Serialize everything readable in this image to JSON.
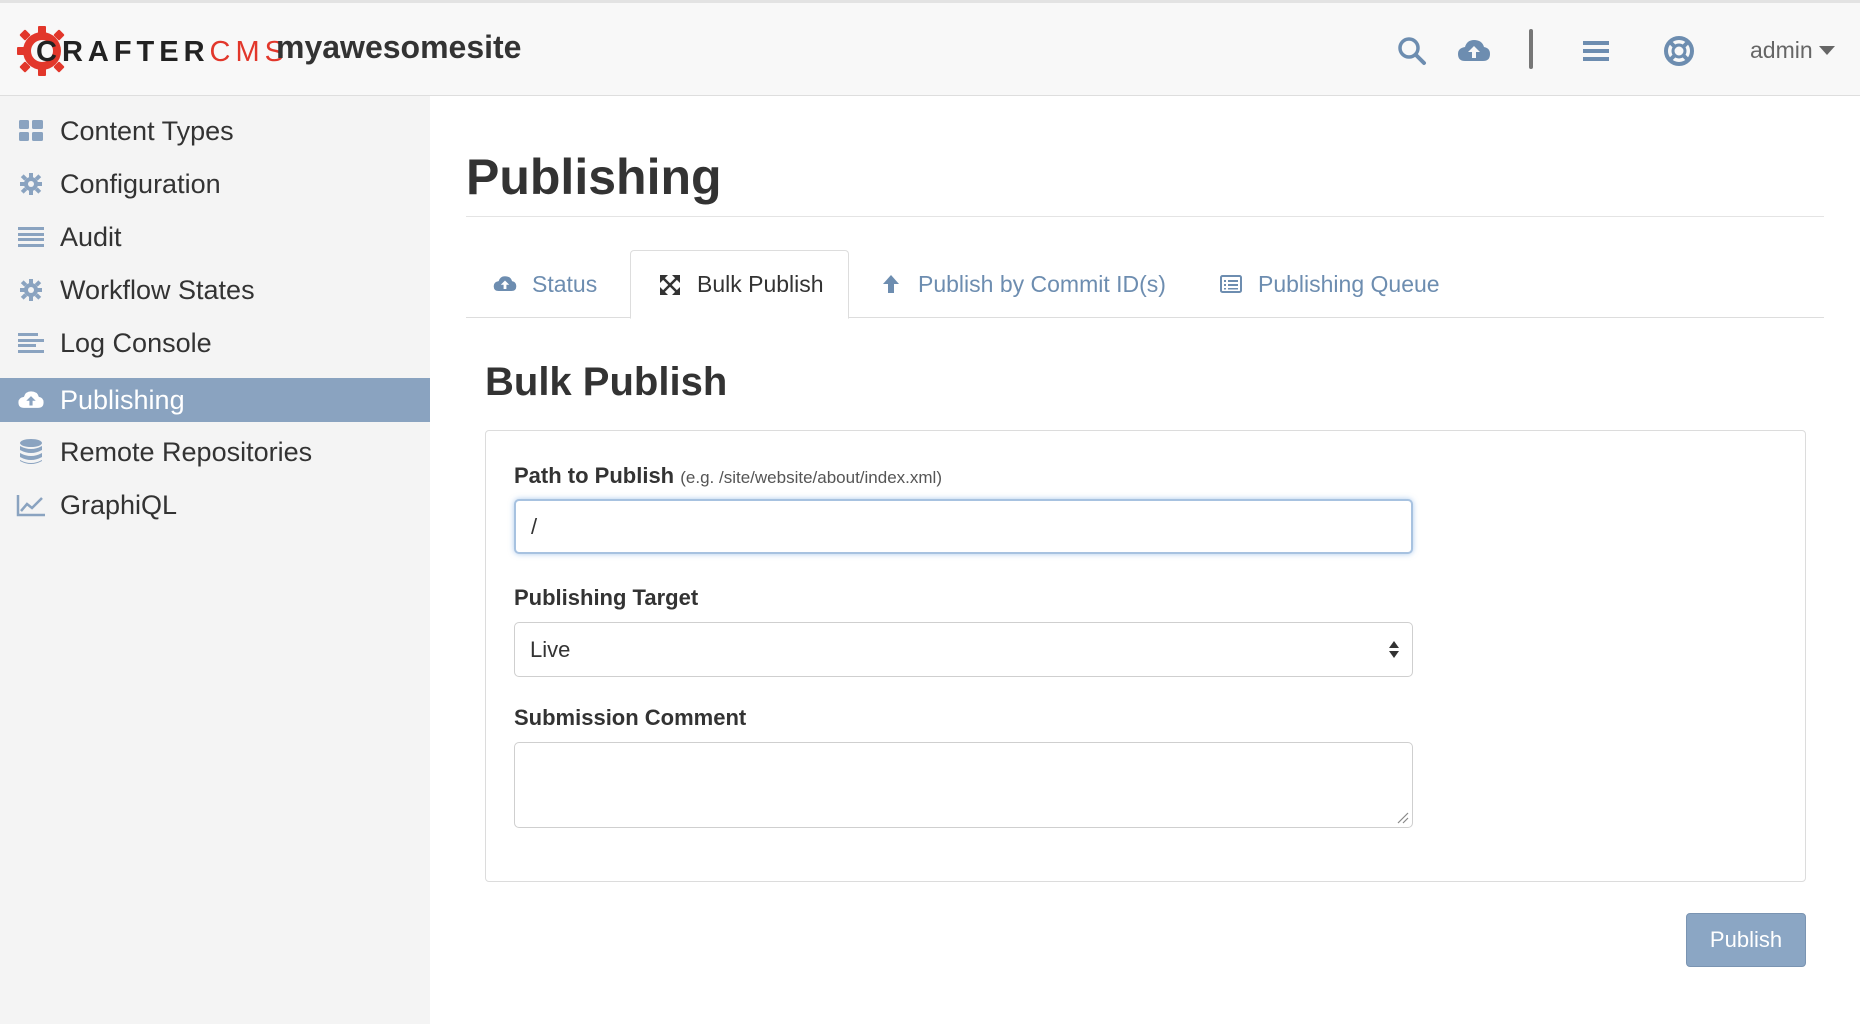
{
  "header": {
    "logo": {
      "word1": "CRAFTER",
      "word2": "CMS"
    },
    "site_name": "myawesomesite",
    "user_label": "admin"
  },
  "sidebar": {
    "items": [
      {
        "label": "Content Types",
        "icon": "grid-icon"
      },
      {
        "label": "Configuration",
        "icon": "gear-icon"
      },
      {
        "label": "Audit",
        "icon": "list-icon"
      },
      {
        "label": "Workflow States",
        "icon": "gear-icon"
      },
      {
        "label": "Log Console",
        "icon": "align-left-icon"
      },
      {
        "label": "Publishing",
        "icon": "cloud-upload-icon",
        "active": true
      },
      {
        "label": "Remote Repositories",
        "icon": "database-icon"
      },
      {
        "label": "GraphiQL",
        "icon": "line-chart-icon"
      }
    ]
  },
  "main": {
    "page_title": "Publishing",
    "tabs": [
      {
        "label": "Status",
        "icon": "cloud-upload-icon"
      },
      {
        "label": "Bulk Publish",
        "icon": "expand-arrows-icon",
        "active": true
      },
      {
        "label": "Publish by Commit ID(s)",
        "icon": "arrow-up-icon"
      },
      {
        "label": "Publishing Queue",
        "icon": "list-alt-icon"
      }
    ],
    "section_title": "Bulk Publish",
    "form": {
      "path_label": "Path to Publish",
      "path_hint": "(e.g. /site/website/about/index.xml)",
      "path_value": "/",
      "target_label": "Publishing Target",
      "target_value": "Live",
      "comment_label": "Submission Comment",
      "comment_value": ""
    },
    "publish_button": "Publish"
  },
  "colors": {
    "accent": "#8aa3c0",
    "link": "#6d8db0",
    "brand_red": "#e2372b",
    "focus_border": "#a7c2e0"
  }
}
